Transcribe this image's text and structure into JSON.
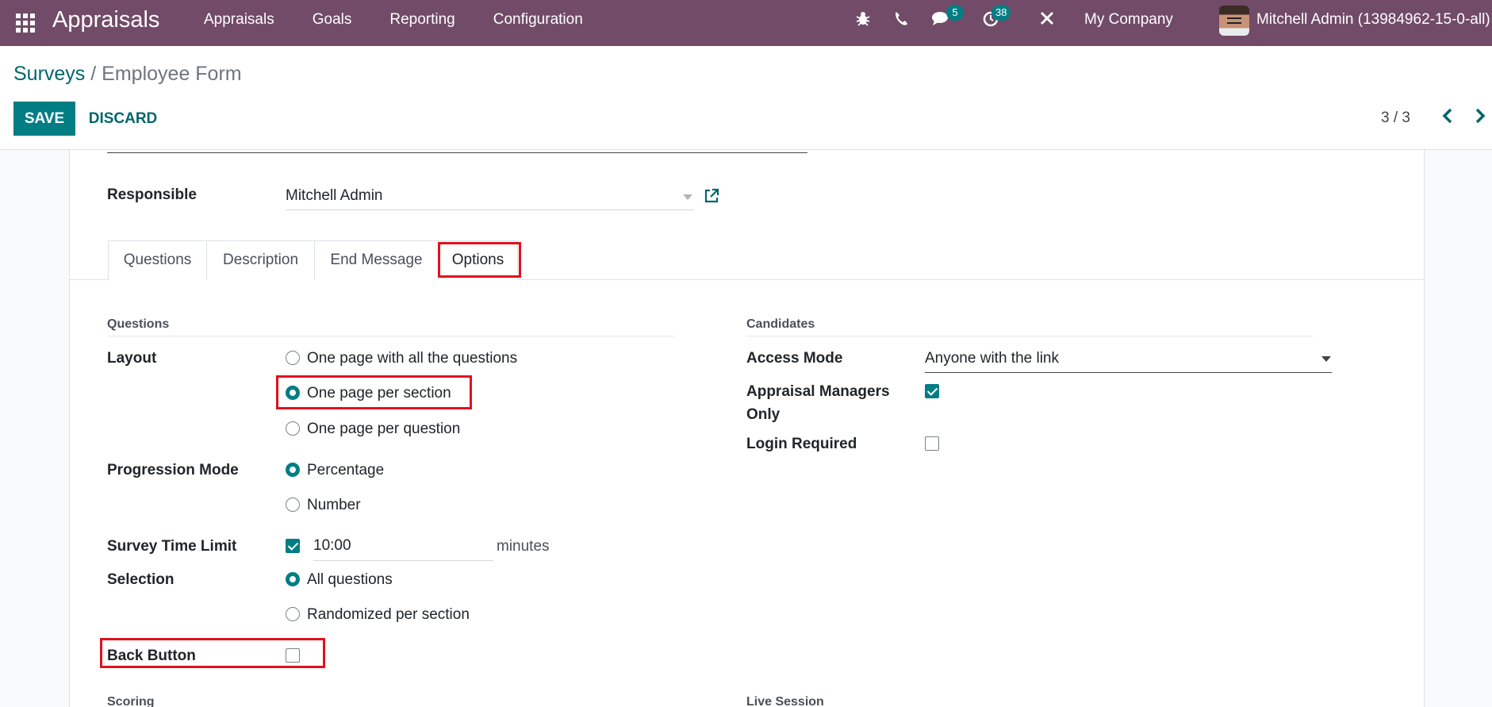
{
  "navbar": {
    "brand": "Appraisals",
    "menu": [
      "Appraisals",
      "Goals",
      "Reporting",
      "Configuration"
    ],
    "messages_badge": "5",
    "activities_badge": "38",
    "company": "My Company",
    "user": "Mitchell Admin (13984962-15-0-all)"
  },
  "breadcrumb": {
    "parent": "Surveys",
    "separator": "/",
    "current": "Employee Form"
  },
  "buttons": {
    "save": "SAVE",
    "discard": "DISCARD"
  },
  "pager": {
    "value": "3 / 3"
  },
  "form": {
    "responsible_label": "Responsible",
    "responsible_value": "Mitchell Admin",
    "tabs": [
      "Questions",
      "Description",
      "End Message",
      "Options"
    ],
    "active_tab": "Options",
    "questions_section": {
      "title": "Questions",
      "layout_label": "Layout",
      "layout_options": [
        "One page with all the questions",
        "One page per section",
        "One page per question"
      ],
      "layout_selected": "One page per section",
      "progression_label": "Progression Mode",
      "progression_options": [
        "Percentage",
        "Number"
      ],
      "progression_selected": "Percentage",
      "time_limit_label": "Survey Time Limit",
      "time_limit_enabled": true,
      "time_limit_value": "10:00",
      "time_limit_unit": "minutes",
      "selection_label": "Selection",
      "selection_options": [
        "All questions",
        "Randomized per section"
      ],
      "selection_selected": "All questions",
      "back_button_label": "Back Button",
      "back_button_checked": false
    },
    "candidates_section": {
      "title": "Candidates",
      "access_mode_label": "Access Mode",
      "access_mode_value": "Anyone with the link",
      "managers_only_label_line1": "Appraisal Managers",
      "managers_only_label_line2": "Only",
      "managers_only_checked": true,
      "login_required_label": "Login Required",
      "login_required_checked": false
    },
    "scoring_title": "Scoring",
    "live_session_title": "Live Session"
  },
  "colors": {
    "navbar": "#714b67",
    "primary": "#017e84",
    "highlight": "#e0121e"
  }
}
